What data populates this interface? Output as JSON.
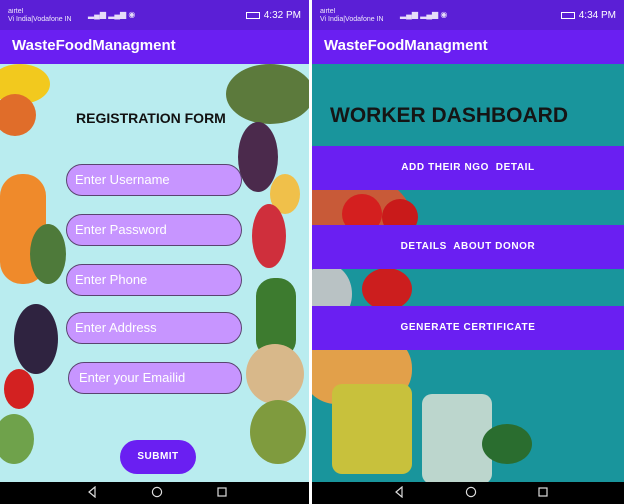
{
  "left_screen": {
    "status": {
      "carrier_line1": "airtel",
      "carrier_line2": "Vi India|Vodafone IN",
      "time": "4:32 PM"
    },
    "app_title": "WasteFoodManagment",
    "form_title": "REGISTRATION FORM",
    "fields": {
      "username_placeholder": "Enter Username",
      "password_placeholder": "Enter Password",
      "phone_placeholder": "Enter Phone",
      "address_placeholder": "Enter Address",
      "email_placeholder": "Enter your Emailid"
    },
    "submit_label": "SUBMIT"
  },
  "right_screen": {
    "status": {
      "carrier_line1": "airtel",
      "carrier_line2": "Vi India|Vodafone IN",
      "time": "4:34 PM"
    },
    "app_title": "WasteFoodManagment",
    "dashboard_title": "WORKER DASHBOARD",
    "buttons": {
      "add_ngo": "ADD THEIR NGO  DETAIL",
      "donor_details": "DETAILS  ABOUT DONOR",
      "certificate": "GENERATE CERTIFICATE"
    }
  },
  "colors": {
    "status_bar": "#5b1fd6",
    "app_bar": "#6a1ff2",
    "field_fill": "#c795ff",
    "left_background": "#b9ecef",
    "right_background": "#19959c"
  },
  "icons": [
    "signal-icon",
    "wifi-icon",
    "battery-icon",
    "back-icon",
    "home-icon",
    "recents-icon"
  ]
}
